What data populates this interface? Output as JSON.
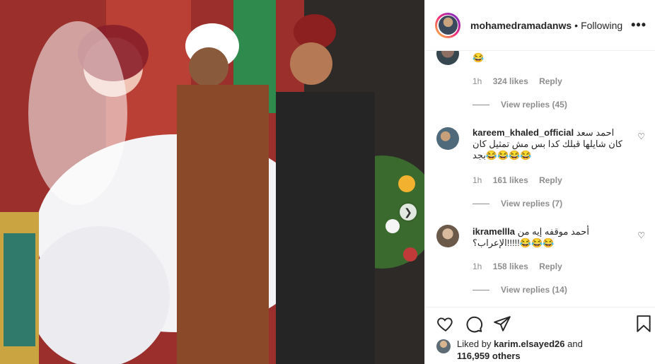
{
  "post": {
    "username": "mohamedramadanws",
    "separator": "•",
    "follow_status": "Following",
    "more_label": "•••"
  },
  "photo": {
    "next_icon": "chevron-right-icon",
    "next_glyph": "❯"
  },
  "comments": [
    {
      "username": "",
      "text": "😂",
      "time": "1h",
      "likes": "324 likes",
      "reply_label": "Reply",
      "view_replies": "View replies (45)"
    },
    {
      "username": "kareem_khaled_official",
      "text": "احمد سعد كان شايلها قبلك كدا بس مش تمثيل كان بجد😂😂😂😂",
      "time": "1h",
      "likes": "161 likes",
      "reply_label": "Reply",
      "view_replies": "View replies (7)"
    },
    {
      "username": "ikramellla",
      "text": "أحمد موقفه إيه من الإعراب؟!!!!!😂😂😂",
      "time": "1h",
      "likes": "158 likes",
      "reply_label": "Reply",
      "view_replies": "View replies (14)"
    }
  ],
  "actions": {
    "like_icon": "heart-icon",
    "comment_icon": "comment-icon",
    "share_icon": "share-icon",
    "save_icon": "bookmark-icon"
  },
  "liked_by": {
    "prefix": "Liked by",
    "user": "karim.elsayed26",
    "and": "and",
    "count": "116,959 others"
  },
  "colors": {
    "text": "#262626",
    "muted": "#8e8e8e",
    "border": "#efefef"
  }
}
